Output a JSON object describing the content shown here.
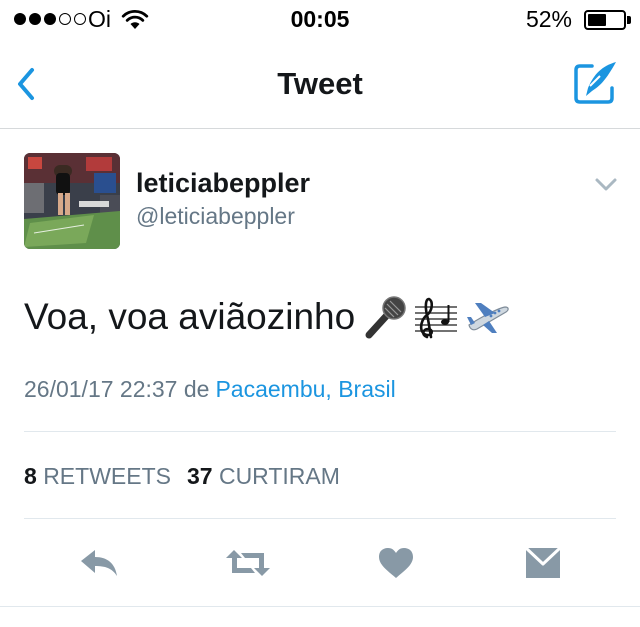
{
  "status_bar": {
    "carrier": "Oi",
    "time": "00:05",
    "battery_pct": "52%",
    "battery_level": 0.52,
    "signal_bars_filled": 3,
    "signal_bars_total": 5
  },
  "nav": {
    "title": "Tweet",
    "back_icon": "chevron-left-icon",
    "compose_icon": "compose-tweet-icon"
  },
  "tweet": {
    "display_name": "leticiabeppler",
    "handle": "@leticiabeppler",
    "text": "Voa, voa aviãozinho",
    "emojis": [
      "microphone-emoji",
      "musical-score-emoji",
      "airplane-emoji"
    ],
    "datetime": "26/01/17 22:37 de",
    "place": "Pacaembu, Brasil"
  },
  "stats": {
    "retweets_count": "8",
    "retweets_label": "RETWEETS",
    "likes_count": "37",
    "likes_label": "CURTIRAM"
  },
  "actions": [
    "reply-icon",
    "retweet-icon",
    "like-icon",
    "direct-message-icon"
  ],
  "colors": {
    "accent": "#1b95e0",
    "text": "#14171a",
    "secondary": "#657786",
    "action": "#8899a6",
    "divider": "#e1e8ed"
  }
}
